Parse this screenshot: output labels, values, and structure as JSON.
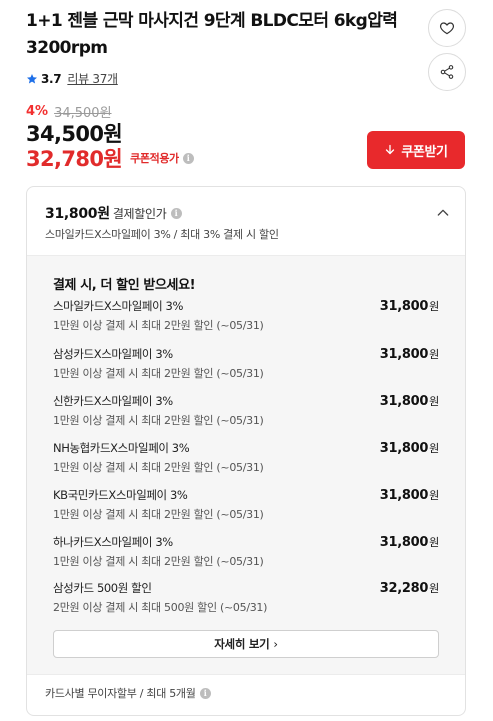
{
  "product": {
    "title": "1+1 젠블 근막 마사지건 9단계 BLDC모터 6kg압력 3200rpm",
    "rating": "3.7",
    "review_label": "리뷰 37개"
  },
  "price": {
    "discount_rate": "4%",
    "original_price": "34,500원",
    "sale_price": "34,500원",
    "coupon_price": "32,780원",
    "coupon_applied_label": "쿠폰적용가"
  },
  "coupon_button": {
    "label": "쿠폰받기"
  },
  "card_discount": {
    "best_amount": "31,800원",
    "best_label": "결제할인가",
    "best_sub": "스마일카드X스마일페이 3% / 최대 3% 결제 시 할인",
    "panel_title": "결제 시, 더 할인 받으세요!",
    "offers": [
      {
        "name": "스마일카드X스마일페이 3%",
        "condition": "1만원 이상 결제 시 최대 2만원 할인 (~05/31)",
        "amount": "31,800",
        "unit": "원"
      },
      {
        "name": "삼성카드X스마일페이 3%",
        "condition": "1만원 이상 결제 시 최대 2만원 할인 (~05/31)",
        "amount": "31,800",
        "unit": "원"
      },
      {
        "name": "신한카드X스마일페이 3%",
        "condition": "1만원 이상 결제 시 최대 2만원 할인 (~05/31)",
        "amount": "31,800",
        "unit": "원"
      },
      {
        "name": "NH농협카드X스마일페이 3%",
        "condition": "1만원 이상 결제 시 최대 2만원 할인 (~05/31)",
        "amount": "31,800",
        "unit": "원"
      },
      {
        "name": "KB국민카드X스마일페이 3%",
        "condition": "1만원 이상 결제 시 최대 2만원 할인 (~05/31)",
        "amount": "31,800",
        "unit": "원"
      },
      {
        "name": "하나카드X스마일페이 3%",
        "condition": "1만원 이상 결제 시 최대 2만원 할인 (~05/31)",
        "amount": "31,800",
        "unit": "원"
      },
      {
        "name": "삼성카드 500원 할인",
        "condition": "2만원 이상 결제 시 최대 500원 할인 (~05/31)",
        "amount": "32,280",
        "unit": "원"
      }
    ],
    "detail_button": "자세히 보기",
    "installment_note": "카드사별 무이자할부 / 최대 5개월"
  },
  "colors": {
    "accent_red": "#e8292c",
    "price_red": "#e12b2b",
    "star_blue": "#1e6fe8"
  }
}
